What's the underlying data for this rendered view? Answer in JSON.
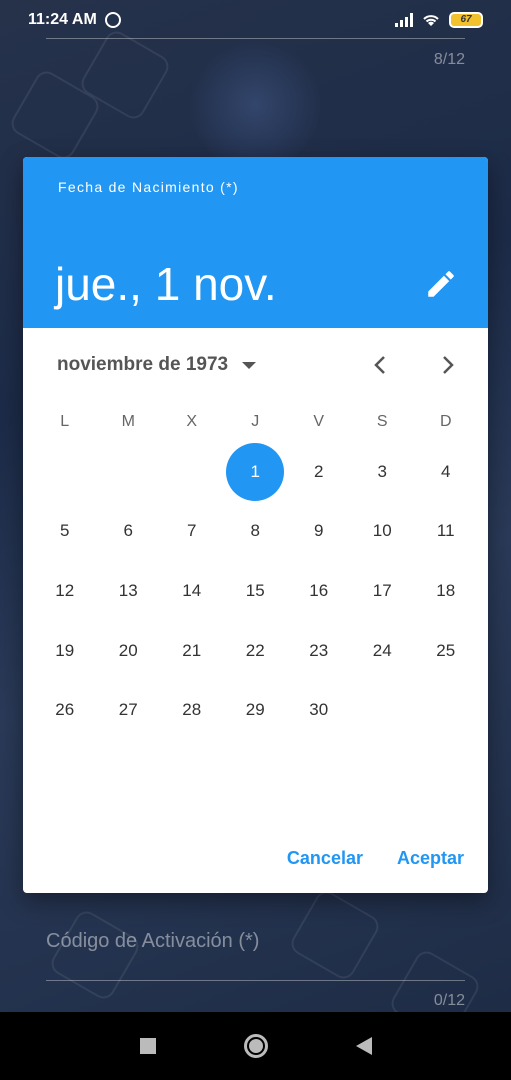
{
  "status_bar": {
    "time": "11:24 AM",
    "battery": "67"
  },
  "background": {
    "counter_top": "8/12",
    "field_label": "Código de Activación (*)",
    "counter_bottom": "0/12"
  },
  "dialog": {
    "help_text": "Fecha de Nacimiento (*)",
    "selected_date": "jue., 1 nov.",
    "month_year": "noviembre de 1973",
    "weekdays": [
      "L",
      "M",
      "X",
      "J",
      "V",
      "S",
      "D"
    ],
    "weeks": [
      [
        "",
        "",
        "",
        "1",
        "2",
        "3",
        "4"
      ],
      [
        "5",
        "6",
        "7",
        "8",
        "9",
        "10",
        "11"
      ],
      [
        "12",
        "13",
        "14",
        "15",
        "16",
        "17",
        "18"
      ],
      [
        "19",
        "20",
        "21",
        "22",
        "23",
        "24",
        "25"
      ],
      [
        "26",
        "27",
        "28",
        "29",
        "30",
        "",
        ""
      ]
    ],
    "selected_day": "1",
    "cancel_label": "Cancelar",
    "accept_label": "Aceptar"
  },
  "colors": {
    "accent": "#2196f3",
    "text": "#333333"
  },
  "icons": {
    "edit": "pencil-icon",
    "prev": "chevron-left-icon",
    "next": "chevron-right-icon",
    "dropdown": "caret-down-icon"
  }
}
